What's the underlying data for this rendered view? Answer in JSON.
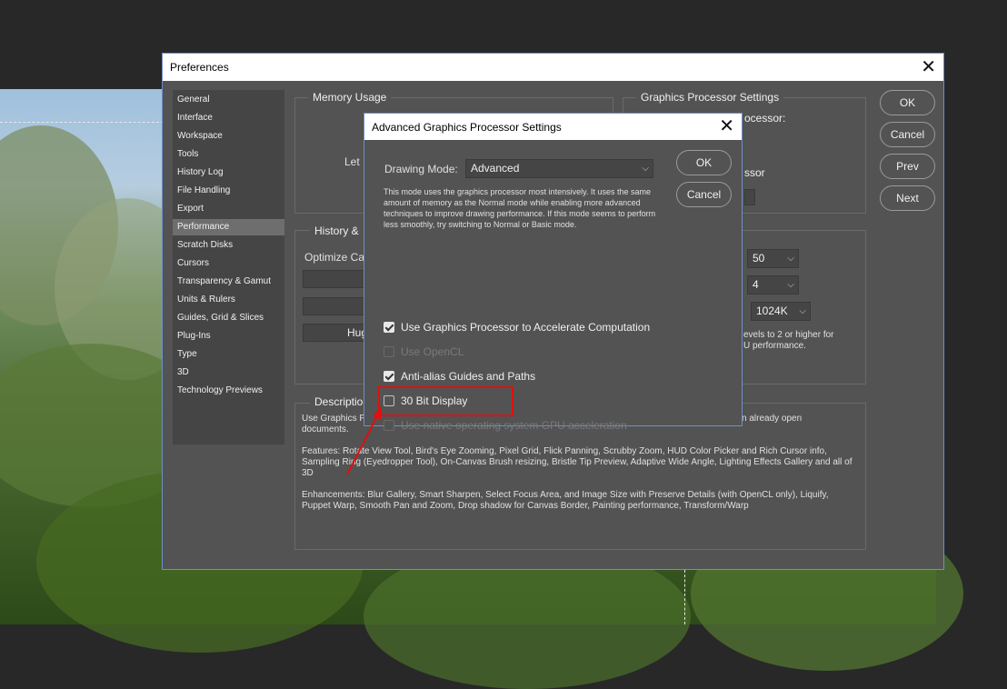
{
  "preferences": {
    "title": "Preferences",
    "sidebar": [
      "General",
      "Interface",
      "Workspace",
      "Tools",
      "History Log",
      "File Handling",
      "Export",
      "Performance",
      "Scratch Disks",
      "Cursors",
      "Transparency & Gamut",
      "Units & Rulers",
      "Guides, Grid & Slices",
      "Plug-Ins",
      "Type",
      "3D",
      "Technology Previews"
    ],
    "active_item": "Performance",
    "buttons": {
      "ok": "OK",
      "cancel": "Cancel",
      "prev": "Prev",
      "next": "Next"
    },
    "memory_usage": {
      "title": "Memory Usage",
      "let_label": "Let"
    },
    "history_cache": {
      "title": "History & ",
      "optimize_label": "Optimize Ca",
      "preset_huge": "Hug"
    },
    "gpu_settings": {
      "title": "Graphics Processor Settings",
      "detected_label": "ocessor:",
      "use_label": "ssor"
    },
    "cache": {
      "history_states": "50",
      "cache_levels": "4",
      "tile_size": "1024K",
      "note_line1": "evels to 2 or higher for",
      "note_line2": "U performance."
    },
    "description": {
      "title": "Descriptio",
      "line1_left": "Use Graphics P",
      "line1_right": "n already open",
      "line2": "documents.",
      "features": "Features: Rotate View Tool, Bird's Eye Zooming, Pixel Grid, Flick Panning, Scrubby Zoom, HUD Color Picker and Rich Cursor info, Sampling Ring (Eyedropper Tool), On-Canvas Brush resizing, Bristle Tip Preview, Adaptive Wide Angle, Lighting Effects Gallery and all of 3D",
      "enhancements": "Enhancements: Blur Gallery, Smart Sharpen, Select Focus Area, and Image Size with Preserve Details (with OpenCL only), Liquify, Puppet Warp, Smooth Pan and Zoom, Drop shadow for Canvas Border, Painting performance, Transform/Warp"
    }
  },
  "advanced_dialog": {
    "title": "Advanced Graphics Processor Settings",
    "drawing_mode_label": "Drawing Mode:",
    "drawing_mode_value": "Advanced",
    "mode_description": "This mode uses the graphics processor most intensively.  It uses the same amount of memory as the Normal mode while enabling more advanced techniques to improve drawing performance.  If this mode seems to perform less smoothly, try switching to Normal or Basic mode.",
    "ok": "OK",
    "cancel": "Cancel",
    "options": [
      {
        "label": "Use Graphics Processor to Accelerate Computation",
        "checked": true,
        "enabled": true
      },
      {
        "label": "Use OpenCL",
        "checked": false,
        "enabled": false
      },
      {
        "label": "Anti-alias Guides and Paths",
        "checked": true,
        "enabled": true
      },
      {
        "label": "30 Bit Display",
        "checked": false,
        "enabled": true
      },
      {
        "label": "Use native operating system GPU acceleration",
        "checked": false,
        "enabled": false
      }
    ]
  },
  "annotation": {
    "color": "#e01010",
    "highlighted": "30 Bit Display"
  }
}
